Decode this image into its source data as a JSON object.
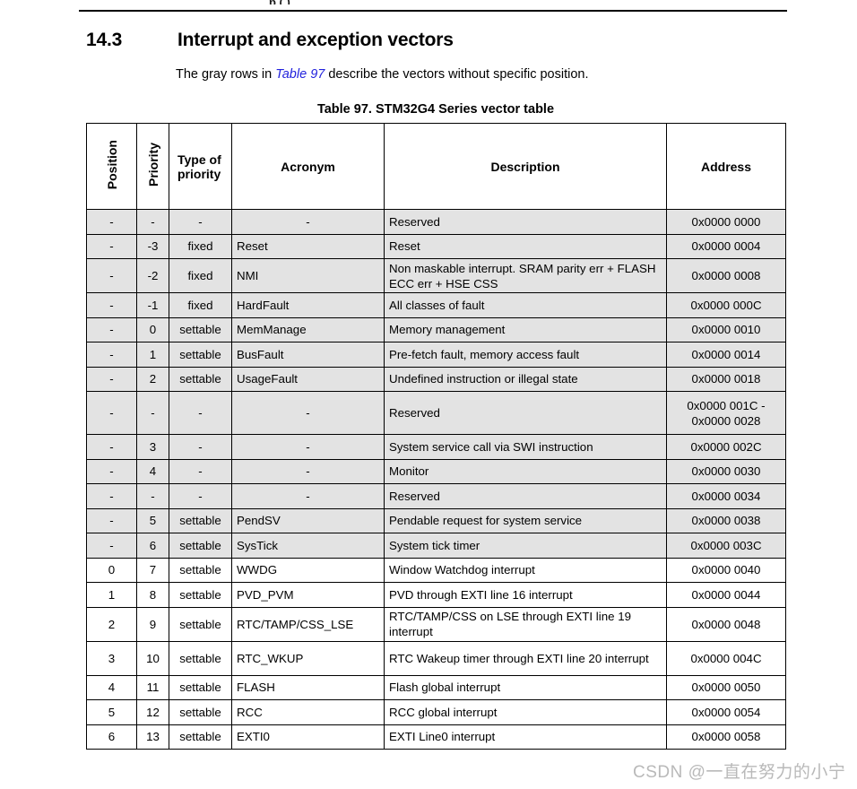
{
  "page": {
    "top_partial_text": "p    (   )",
    "section_number": "14.3",
    "section_title": "Interrupt and exception vectors",
    "intro_prefix": "The gray rows in ",
    "intro_link": "Table 97",
    "intro_suffix": " describe the vectors without specific position.",
    "table_caption": "Table 97. STM32G4 Series vector table",
    "watermark": "CSDN @一直在努力的小宁",
    "link_color": "#2222dd",
    "gray_row_color": "#e3e3e3"
  },
  "table": {
    "headers": {
      "position": "Position",
      "priority": "Priority",
      "type_of_priority": "Type of priority",
      "acronym": "Acronym",
      "description": "Description",
      "address": "Address"
    },
    "rows": [
      {
        "position": "-",
        "priority": "-",
        "type": "-",
        "acronym": "-",
        "description": "Reserved",
        "address": "0x0000 0000",
        "gray": true,
        "height": "normal"
      },
      {
        "position": "-",
        "priority": "-3",
        "type": "fixed",
        "acronym": "Reset",
        "description": "Reset",
        "address": "0x0000 0004",
        "gray": true,
        "height": "normal"
      },
      {
        "position": "-",
        "priority": "-2",
        "type": "fixed",
        "acronym": "NMI",
        "description": "Non maskable interrupt. SRAM parity err + FLASH ECC err + HSE CSS",
        "address": "0x0000 0008",
        "gray": true,
        "height": "tall2"
      },
      {
        "position": "-",
        "priority": "-1",
        "type": "fixed",
        "acronym": "HardFault",
        "description": "All classes of fault",
        "address": "0x0000 000C",
        "gray": true,
        "height": "normal"
      },
      {
        "position": "-",
        "priority": "0",
        "type": "settable",
        "acronym": "MemManage",
        "description": "Memory management",
        "address": "0x0000 0010",
        "gray": true,
        "height": "normal"
      },
      {
        "position": "-",
        "priority": "1",
        "type": "settable",
        "acronym": "BusFault",
        "description": "Pre-fetch fault, memory access fault",
        "address": "0x0000 0014",
        "gray": true,
        "height": "normal"
      },
      {
        "position": "-",
        "priority": "2",
        "type": "settable",
        "acronym": "UsageFault",
        "description": "Undefined instruction or illegal state",
        "address": "0x0000 0018",
        "gray": true,
        "height": "normal"
      },
      {
        "position": "-",
        "priority": "-",
        "type": "-",
        "acronym": "-",
        "description": "Reserved",
        "address": "0x0000 001C - 0x0000 0028",
        "gray": true,
        "height": "tall3"
      },
      {
        "position": "-",
        "priority": "3",
        "type": "-",
        "acronym": "-",
        "description": "System service call via SWI instruction",
        "address": "0x0000 002C",
        "gray": true,
        "height": "normal"
      },
      {
        "position": "-",
        "priority": "4",
        "type": "-",
        "acronym": "-",
        "description": "Monitor",
        "address": "0x0000 0030",
        "gray": true,
        "height": "normal"
      },
      {
        "position": "-",
        "priority": "-",
        "type": "-",
        "acronym": "-",
        "description": "Reserved",
        "address": "0x0000 0034",
        "gray": true,
        "height": "normal"
      },
      {
        "position": "-",
        "priority": "5",
        "type": "settable",
        "acronym": "PendSV",
        "description": "Pendable request for system service",
        "address": "0x0000 0038",
        "gray": true,
        "height": "normal"
      },
      {
        "position": "-",
        "priority": "6",
        "type": "settable",
        "acronym": "SysTick",
        "description": "System tick timer",
        "address": "0x0000 003C",
        "gray": true,
        "height": "normal"
      },
      {
        "position": "0",
        "priority": "7",
        "type": "settable",
        "acronym": "WWDG",
        "description": "Window Watchdog interrupt",
        "address": "0x0000 0040",
        "gray": false,
        "height": "normal"
      },
      {
        "position": "1",
        "priority": "8",
        "type": "settable",
        "acronym": "PVD_PVM",
        "description": "PVD through EXTI line 16 interrupt",
        "address": "0x0000 0044",
        "gray": false,
        "height": "normal"
      },
      {
        "position": "2",
        "priority": "9",
        "type": "settable",
        "acronym": "RTC/TAMP/CSS_LSE",
        "description": "RTC/TAMP/CSS on LSE through EXTI line 19 interrupt",
        "address": "0x0000 0048",
        "gray": false,
        "height": "tall2"
      },
      {
        "position": "3",
        "priority": "10",
        "type": "settable",
        "acronym": "RTC_WKUP",
        "description": "RTC Wakeup timer through EXTI line 20 interrupt",
        "address": "0x0000 004C",
        "gray": false,
        "height": "tall2"
      },
      {
        "position": "4",
        "priority": "11",
        "type": "settable",
        "acronym": "FLASH",
        "description": "Flash global interrupt",
        "address": "0x0000 0050",
        "gray": false,
        "height": "normal"
      },
      {
        "position": "5",
        "priority": "12",
        "type": "settable",
        "acronym": "RCC",
        "description": "RCC global interrupt",
        "address": "0x0000 0054",
        "gray": false,
        "height": "normal"
      },
      {
        "position": "6",
        "priority": "13",
        "type": "settable",
        "acronym": "EXTI0",
        "description": "EXTI Line0 interrupt",
        "address": "0x0000 0058",
        "gray": false,
        "height": "normal"
      }
    ]
  }
}
